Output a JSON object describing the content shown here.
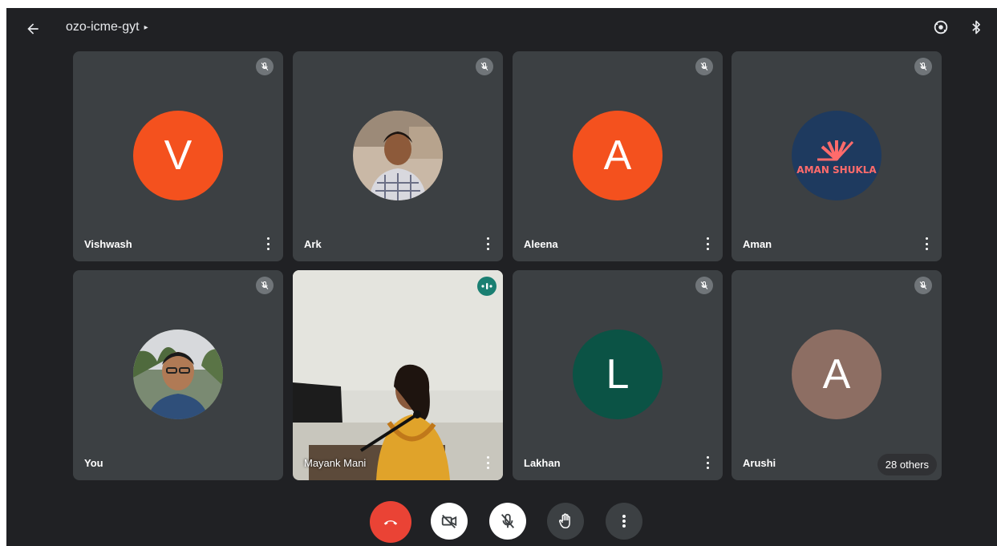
{
  "header": {
    "meeting_code": "ozo-icme-gyt",
    "caret": "▸"
  },
  "participants": [
    {
      "name": "Vishwash",
      "initial": "V",
      "avatar_color": "#f4511e",
      "muted": true
    },
    {
      "name": "Ark",
      "initial": "",
      "avatar_type": "photo",
      "muted": true
    },
    {
      "name": "Aleena",
      "initial": "A",
      "avatar_color": "#f4511e",
      "muted": true
    },
    {
      "name": "Aman",
      "initial": "",
      "avatar_type": "logo",
      "logo_text": "AMAN SHUKLA",
      "avatar_color": "#1e3a5f",
      "muted": true
    },
    {
      "name": "You",
      "initial": "",
      "avatar_type": "photo",
      "muted": true
    },
    {
      "name": "Mayank Mani",
      "initial": "",
      "avatar_type": "video",
      "speaking": true
    },
    {
      "name": "Lakhan",
      "initial": "L",
      "avatar_color": "#0b5345",
      "muted": true
    },
    {
      "name": "Arushi",
      "initial": "A",
      "avatar_color": "#8d6e63",
      "muted": true
    }
  ],
  "others_badge": "28 others",
  "controls": {
    "end_call": "end-call",
    "camera": "camera-off",
    "mic": "mic-off",
    "raise_hand": "raise-hand",
    "more": "more-options"
  },
  "colors": {
    "background": "#202124",
    "tile": "#3c4043",
    "end_call": "#ea4335",
    "speaking": "#1a7f72"
  }
}
